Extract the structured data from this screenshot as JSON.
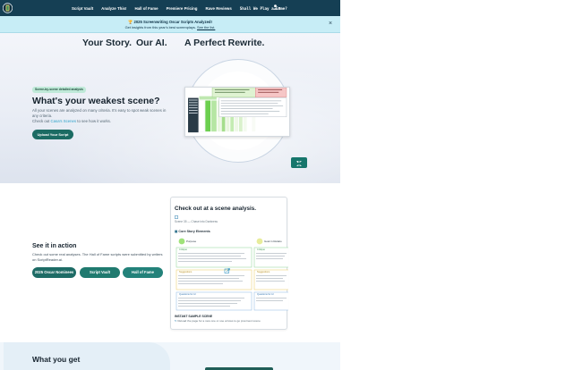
{
  "nav": {
    "items": [
      {
        "label": "Script Vault"
      },
      {
        "label": "Analyze This!"
      },
      {
        "label": "Hall of Fame"
      },
      {
        "label": "Premiere Pricing"
      },
      {
        "label": "Rave Reviews"
      },
      {
        "label": "Shall We Play a Game?"
      }
    ],
    "user_caret": "▾"
  },
  "announcement": {
    "title": "🏆 2025 Screenwriting Oscar Scripts Analyzed!",
    "text": "Get insights from this year's best screenplays.",
    "link": "See the list.",
    "close": "×"
  },
  "hero": {
    "tagline": [
      "Your Story.",
      "Our AI.",
      "A Perfect Rewrite."
    ],
    "badge": "Scene-by-scene detailed analysis",
    "title": "What's your weakest scene?",
    "text_1": "All your scenes are analyzed on many criteria. It's easy to spot weak scenes in any criteria.",
    "text_2_prefix": "Check out ",
    "text_2_link": "Casa's Scenes",
    "text_2_suffix": " to see how it works.",
    "upload_button": "Upload Your Script"
  },
  "action": {
    "title": "See it in action",
    "text": "Check out some real analyses. The Hall of Fame scripts were submitted by writers on ScriptReader.ai.",
    "buttons": [
      "2025 Oscar Nominees",
      "Script Vault",
      "Hall of Fame"
    ],
    "card": {
      "title": "Check out at a scene analysis.",
      "scene": "Scene 35 — Chase into Darkness",
      "section": "Core Story Elements",
      "col1": "Purpose",
      "col2": "Goal in Relatio",
      "critique_label": "Critique",
      "suggestions_label": "Suggestions",
      "questions_label": "Questions for AI",
      "footer": "INSTANT SAMPLE SCENE",
      "footer_sub": "Reload the page for a new one or use arrows to go prev/next scene"
    }
  },
  "get": {
    "title": "What you get"
  }
}
